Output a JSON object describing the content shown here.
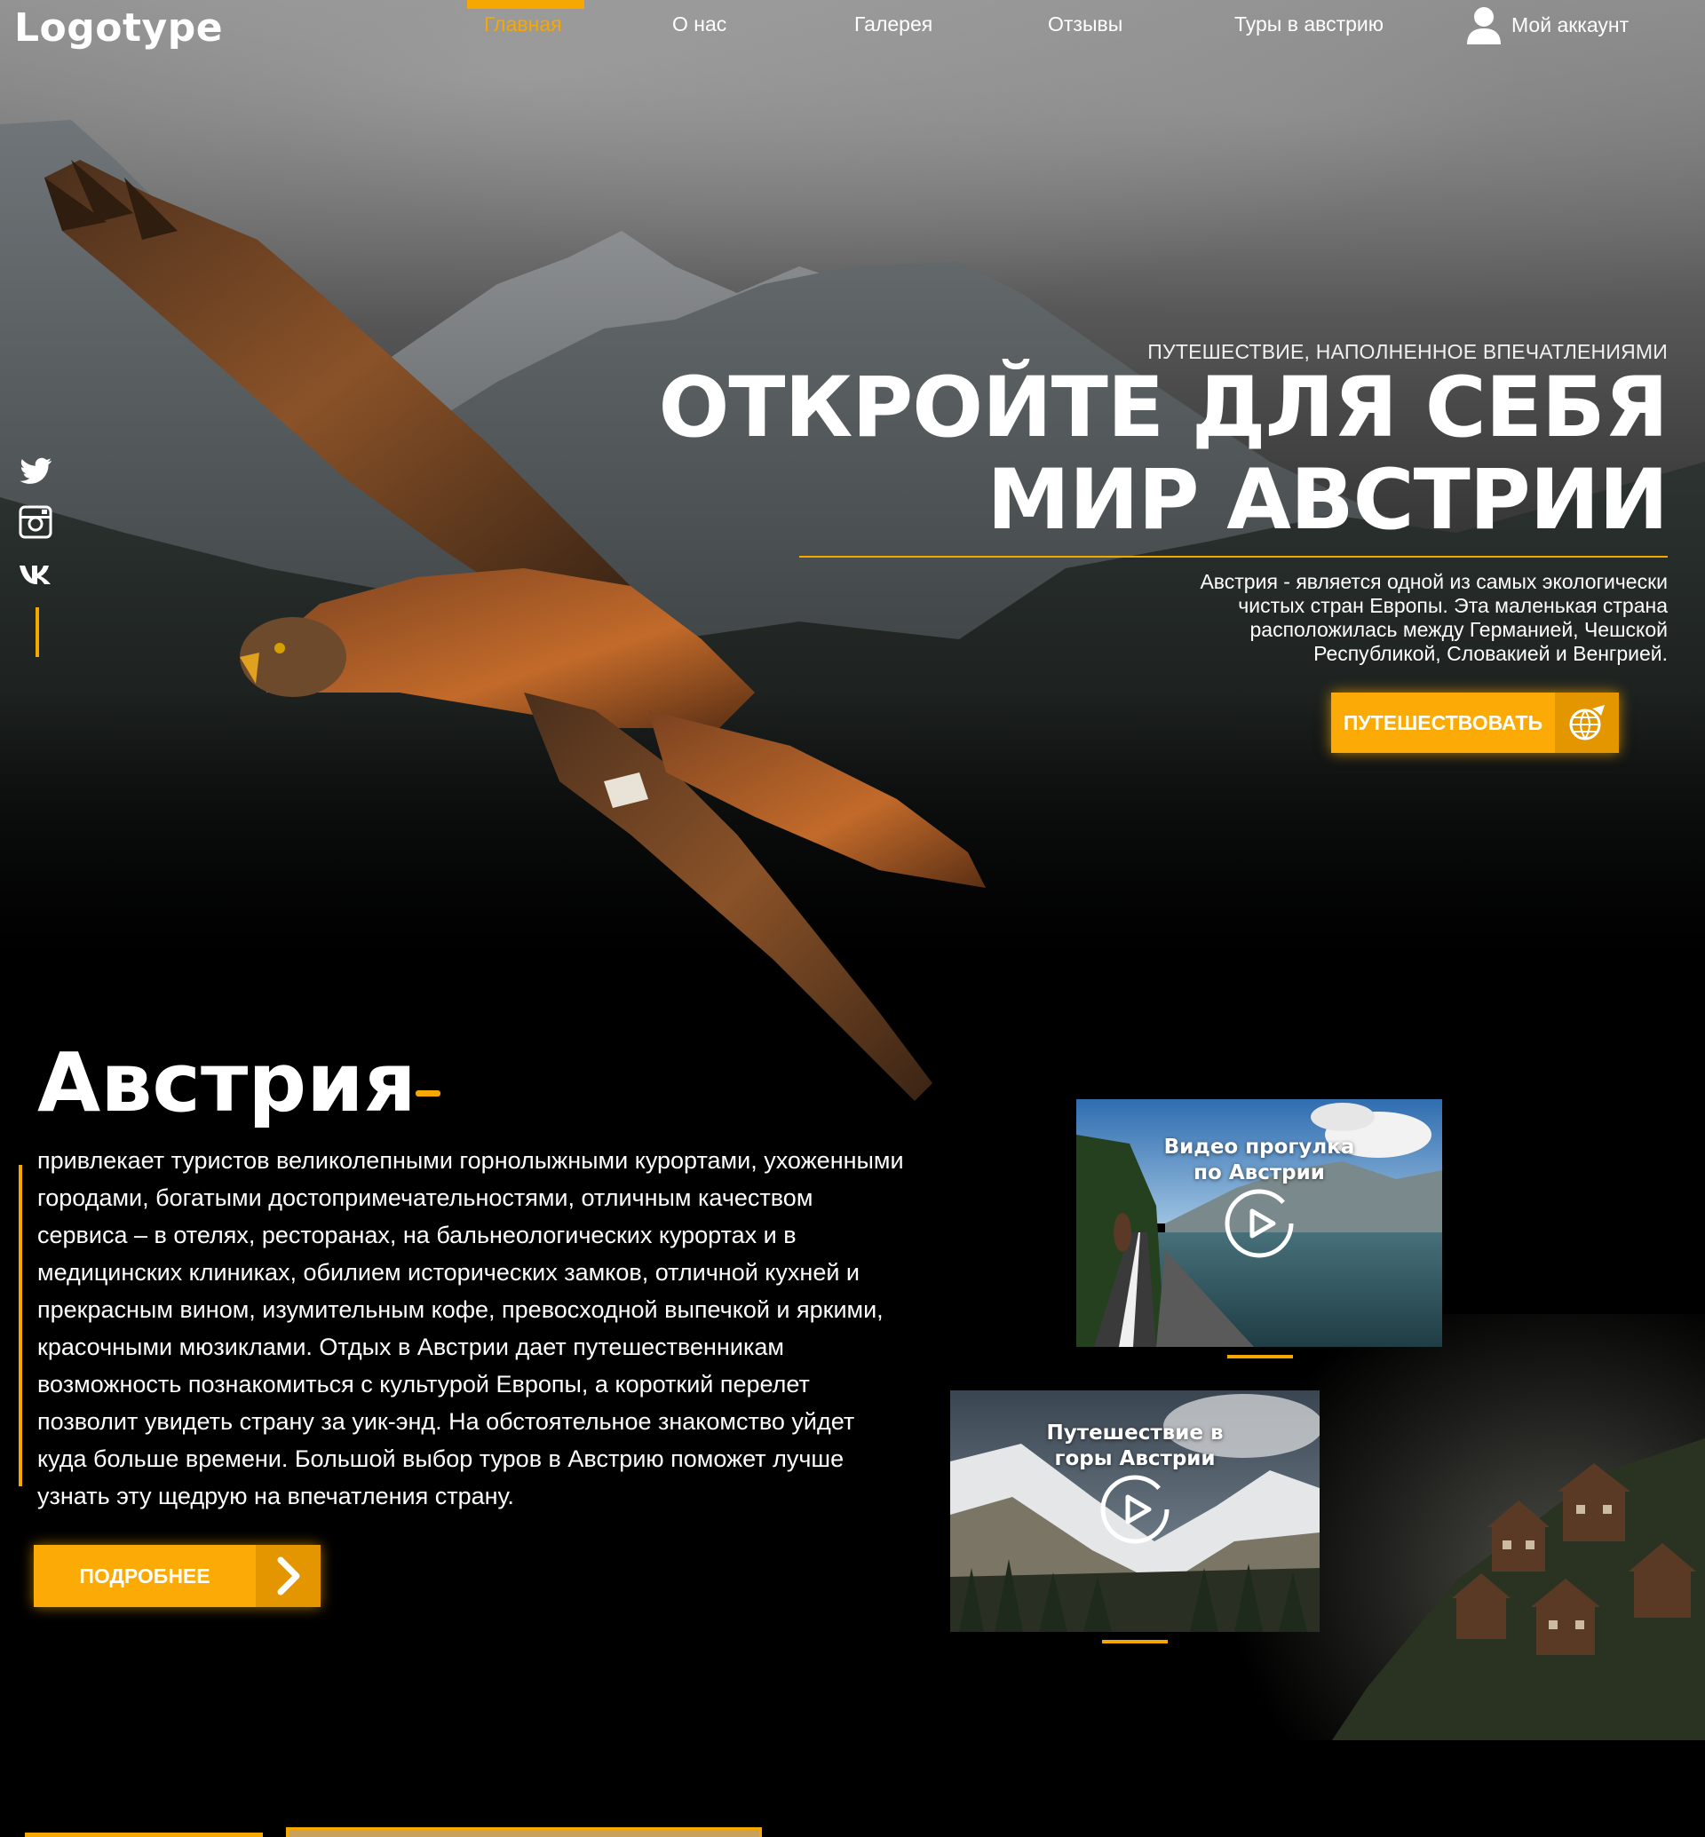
{
  "header": {
    "logo": "Logotype",
    "nav": [
      {
        "label": "Главная",
        "active": true
      },
      {
        "label": "О нас"
      },
      {
        "label": "Галерея"
      },
      {
        "label": "Отзывы"
      },
      {
        "label": "Туры в австрию"
      }
    ],
    "account_label": "Мой аккаунт",
    "account_icon": "user-icon"
  },
  "social": {
    "icons": [
      "twitter-icon",
      "instagram-icon",
      "vk-icon"
    ]
  },
  "hero": {
    "tagline": "ПУТЕШЕСТВИЕ, НАПОЛНЕННОЕ ВПЕЧАТЛЕНИЯМИ",
    "title_line1": "ОТКРОЙТЕ ДЛЯ СЕБЯ",
    "title_line2": "МИР АВСТРИИ",
    "description": "Австрия - является одной из самых экологически чистых стран Европы. Эта маленькая страна расположилась между Германией, Чешской Республикой, Словакией и Венгрией.",
    "button_label": "ПУТЕШЕСТВОВАТЬ",
    "button_icon": "globe-plane-icon"
  },
  "about": {
    "title": "Австрия",
    "text": "привлекает туристов великолепными горнолыжными курортами, ухоженными городами, богатыми достопримечательностями, отличным качеством сервиса – в отелях, ресторанах, на бальнеологических курортах и в медицинских клиниках, обилием исторических замков, отличной кухней и прекрасным вином, изумительным кофе, превосходной выпечкой и яркими, красочными мюзиклами. Отдых в Австрии дает путешественникам возможность познакомиться с культурой Европы, а короткий перелет позволит увидеть страну за уик-энд. На обстоятельное знакомство уйдет куда больше времени. Большой выбор туров в Австрию поможет лучше узнать эту щедрую на впечатления страну.",
    "button_label": "ПОДРОБНЕЕ",
    "button_icon": "chevron-right-icon"
  },
  "videos": [
    {
      "title_line1": "Видео прогулка",
      "title_line2": "по Австрии",
      "icon": "play-icon"
    },
    {
      "title_line1": "Путешествие в",
      "title_line2": "горы Австрии",
      "icon": "play-icon"
    }
  ],
  "colors": {
    "accent": "#f6a800",
    "button": "#fcaa05",
    "button_icon_bg": "#e39600",
    "background": "#000000"
  }
}
